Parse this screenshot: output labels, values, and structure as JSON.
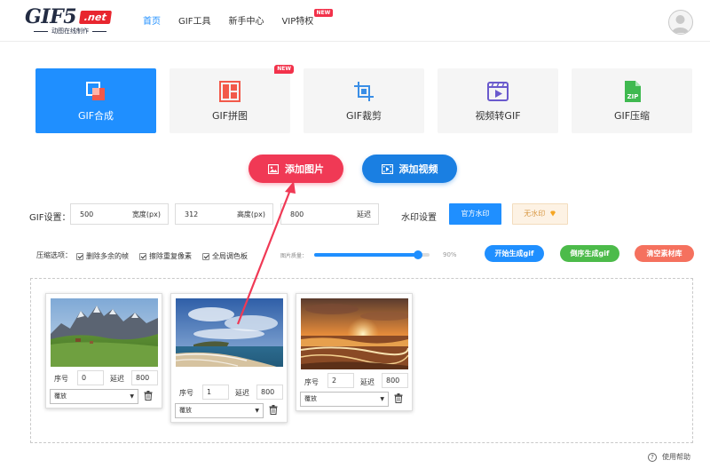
{
  "header": {
    "logo_main": "GIF5",
    "logo_net": ".net",
    "logo_sub": "动图在线制作",
    "nav": [
      {
        "label": "首页"
      },
      {
        "label": "GIF工具"
      },
      {
        "label": "新手中心"
      },
      {
        "label": "VIP特权",
        "badge": "NEW"
      }
    ]
  },
  "tools": [
    {
      "label": "GIF合成",
      "active": true
    },
    {
      "label": "GIF拼图",
      "badge": "NEW"
    },
    {
      "label": "GIF裁剪"
    },
    {
      "label": "视频转GIF"
    },
    {
      "label": "GIF压缩",
      "icon_text": "ZIP"
    }
  ],
  "add_buttons": {
    "image": "添加图片",
    "video": "添加视频"
  },
  "gif_settings": {
    "label": "GIF设置：",
    "width_value": "500",
    "width_suffix": "宽度(px)",
    "height_value": "312",
    "height_suffix": "高度(px)",
    "delay_value": "800",
    "delay_suffix": "延迟"
  },
  "watermark": {
    "label": "水印设置",
    "official": "官方水印",
    "none": "无水印"
  },
  "compress": {
    "label": "压缩选项：",
    "options": [
      {
        "label": "删除多余的帧",
        "checked": true
      },
      {
        "label": "擦除重复像素",
        "checked": true
      },
      {
        "label": "全局调色板",
        "checked": true
      }
    ],
    "quality_label": "图片质量：",
    "quality_value": "90%",
    "quality_fraction": 0.9
  },
  "actions": {
    "start": "开始生成gif",
    "reverse": "倒序生成gif",
    "clear": "清空素材库"
  },
  "frame_labels": {
    "order": "序号",
    "delay": "延迟"
  },
  "frames": [
    {
      "order": "0",
      "delay": "800",
      "mode": "覆放"
    },
    {
      "order": "1",
      "delay": "800",
      "mode": "覆放"
    },
    {
      "order": "2",
      "delay": "800",
      "mode": "覆放"
    }
  ],
  "help": {
    "label": "使用帮助",
    "icon": "?"
  },
  "colors": {
    "primary": "#1f8fff",
    "red": "#f03955",
    "green": "#4cbb4a",
    "orange": "#f5715e"
  }
}
